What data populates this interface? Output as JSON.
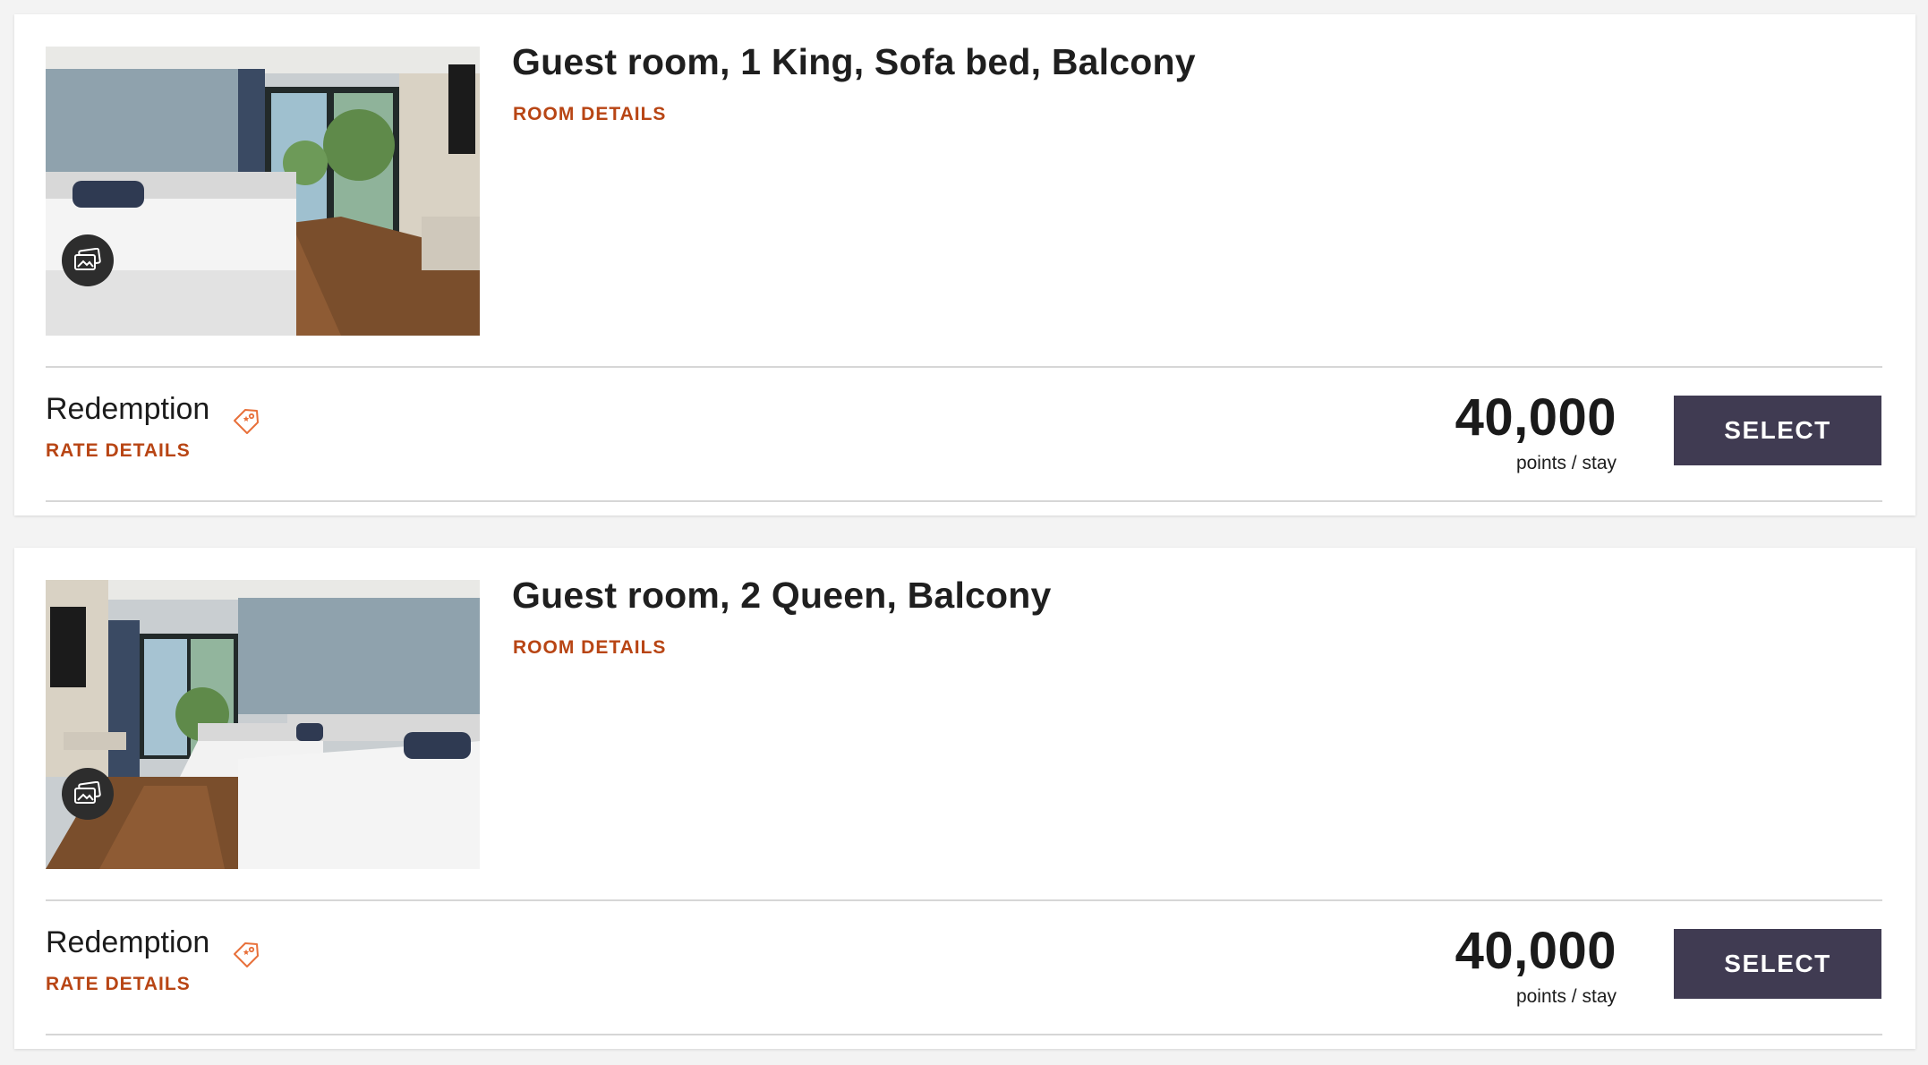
{
  "rooms": [
    {
      "title": "Guest room, 1 King, Sofa bed, Balcony",
      "details_link": "ROOM DETAILS",
      "photo_icon": "photo-gallery-icon",
      "rate": {
        "name": "Redemption",
        "tag_icon": "offer-tag-icon",
        "details_link": "RATE DETAILS",
        "amount": "40,000",
        "unit": "points / stay",
        "select_label": "SELECT"
      }
    },
    {
      "title": "Guest room, 2 Queen, Balcony",
      "details_link": "ROOM DETAILS",
      "photo_icon": "photo-gallery-icon",
      "rate": {
        "name": "Redemption",
        "tag_icon": "offer-tag-icon",
        "details_link": "RATE DETAILS",
        "amount": "40,000",
        "unit": "points / stay",
        "select_label": "SELECT"
      }
    }
  ],
  "colors": {
    "link_accent": "#b84514",
    "tag_icon": "#e8703a",
    "button_bg": "#403b52",
    "button_text": "#ffffff",
    "page_bg": "#f3f3f3",
    "card_bg": "#ffffff"
  }
}
